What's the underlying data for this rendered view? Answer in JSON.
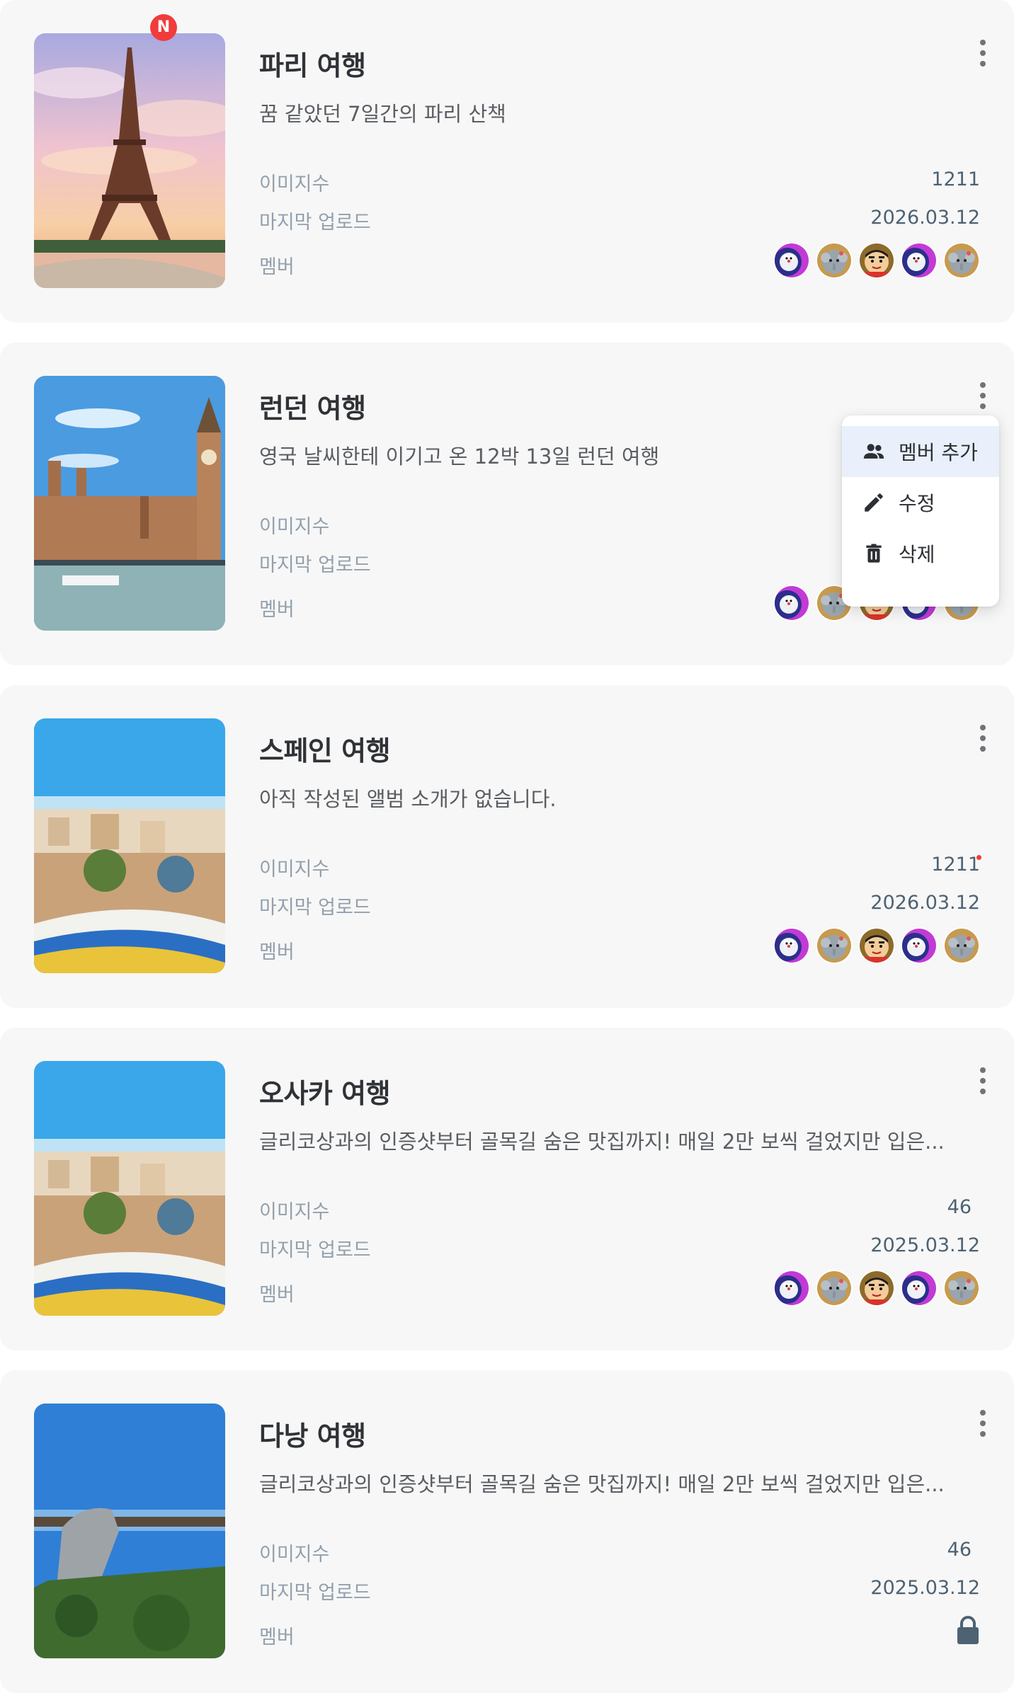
{
  "labels": {
    "image_count": "이미지수",
    "last_upload": "마지막 업로드",
    "members": "멤버"
  },
  "albums": [
    {
      "title": "파리 여행",
      "description": "꿈 같았던 7일간의 파리 산책",
      "image_count": "1211",
      "last_upload": "2026.03.12",
      "badge": "N",
      "members": [
        "doraemon-avatar",
        "elephant-avatar",
        "shinchan-avatar",
        "doraemon-avatar",
        "elephant-avatar"
      ]
    },
    {
      "title": "런던 여행",
      "description": "영국 날씨한테 이기고 온 12박 13일 런던 여행",
      "members": [
        "doraemon-avatar",
        "elephant-avatar",
        "shinchan-avatar",
        "doraemon-avatar",
        "elephant-avatar"
      ]
    },
    {
      "title": "스페인 여행",
      "description": "아직 작성된 앨범 소개가 없습니다.",
      "image_count": "1211",
      "last_upload": "2026.03.12",
      "members": [
        "doraemon-avatar",
        "elephant-avatar",
        "shinchan-avatar",
        "doraemon-avatar",
        "elephant-avatar"
      ]
    },
    {
      "title": "오사카 여행",
      "description": "글리코상과의 인증샷부터 골목길 숨은 맛집까지! 매일 2만 보씩 걸었지만 입은...",
      "image_count": "46",
      "last_upload": "2025.03.12",
      "members": [
        "doraemon-avatar",
        "elephant-avatar",
        "shinchan-avatar",
        "doraemon-avatar",
        "elephant-avatar"
      ]
    },
    {
      "title": "다낭 여행",
      "description": "글리코상과의 인증샷부터 골목길 숨은 맛집까지! 매일 2만 보씩 걸었지만 입은...",
      "image_count": "46",
      "last_upload": "2025.03.12",
      "locked": true
    }
  ],
  "context_menu": {
    "items": [
      {
        "label": "멤버 추가",
        "icon": "people-icon"
      },
      {
        "label": "수정",
        "icon": "pencil-icon"
      },
      {
        "label": "삭제",
        "icon": "trash-icon"
      }
    ]
  },
  "colors": {
    "card_bg": "#f7f7f7",
    "label": "#93a0ad",
    "value": "#4d6273",
    "badge": "#f23b3b",
    "menu_active": "#e9f0fb"
  }
}
